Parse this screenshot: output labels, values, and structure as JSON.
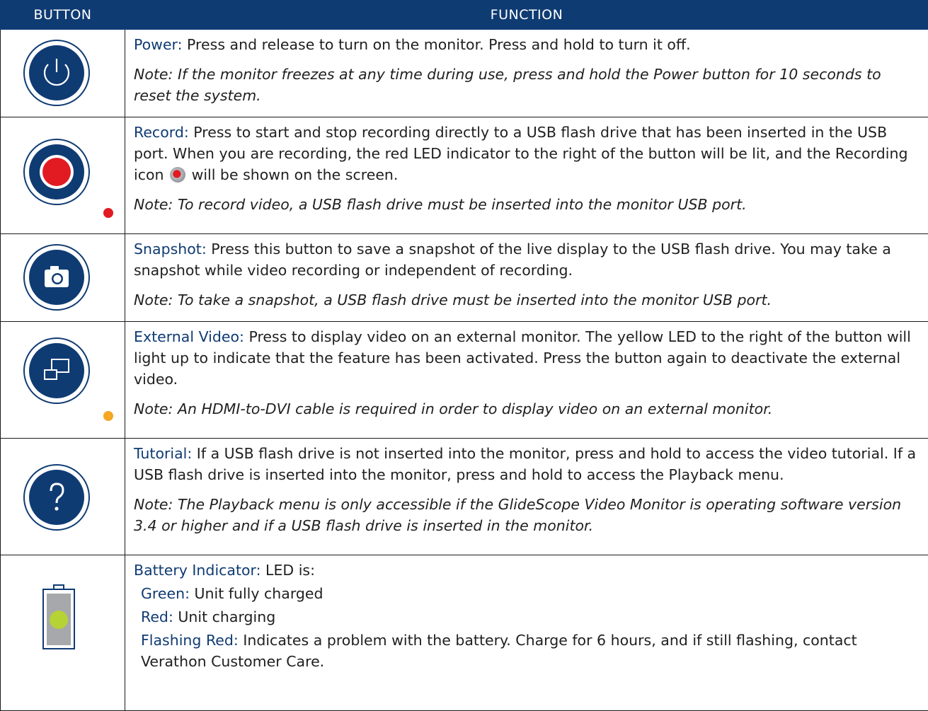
{
  "header": {
    "col_button": "BUTTON",
    "col_function": "FUNCTION"
  },
  "rows": {
    "power": {
      "icon": "power-icon",
      "label": "Power:",
      "text": " Press and release to turn on the monitor. Press and hold to turn it off.",
      "note": "Note: If the monitor freezes at any time during use, press and hold the Power button for 10 seconds to reset the system."
    },
    "record": {
      "icon": "record-icon",
      "led_color": "#e21b22",
      "label": "Record:",
      "text_a": " Press to start and stop recording directly to a USB flash drive that has been inserted in the USB port. When you are recording, the red LED indicator to the right of the button will be lit, and the Recording icon",
      "text_b": " will be shown on the screen.",
      "note": "Note: To record video, a USB flash drive must be inserted into the monitor USB port."
    },
    "snapshot": {
      "icon": "camera-icon",
      "label": "Snapshot:",
      "text": " Press this button to save a snapshot of the live display to the USB flash drive. You may take a snapshot while video recording or independent of recording.",
      "note": "Note: To take a snapshot, a USB flash drive must be inserted into the monitor USB port."
    },
    "external": {
      "icon": "external-display-icon",
      "led_color": "#f5a623",
      "label": "External Video:",
      "text": " Press to display video on an external monitor. The yellow LED to the right of the button will light up to indicate that the feature has been activated. Press the button again to deactivate the external video.",
      "note": "Note: An HDMI-to-DVI cable is required in order to display video on an external monitor."
    },
    "tutorial": {
      "icon": "question-icon",
      "label": "Tutorial:",
      "text": " If a USB flash drive is not inserted into the monitor, press and hold to access the video tutorial. If a USB flash drive is inserted into the monitor, press and hold to access the Playback menu.",
      "note": "Note: The Playback menu is only accessible if the GlideScope Video Monitor is operating software version 3.4 or higher and if a USB flash drive is inserted in the monitor."
    },
    "battery": {
      "icon": "battery-icon",
      "led_color": "#b5d334",
      "label": "Battery Indicator:",
      "text": " LED is:",
      "items": [
        {
          "label": "Green:",
          "text": " Unit fully charged"
        },
        {
          "label": "Red:",
          "text": " Unit charging"
        },
        {
          "label": "Flashing Red:",
          "text": " Indicates a problem with the battery. Charge for 6 hours, and if still flashing, contact Verathon Customer Care."
        }
      ]
    }
  },
  "colors": {
    "brand_blue": "#0f3b73",
    "border": "#1a1a1a"
  }
}
